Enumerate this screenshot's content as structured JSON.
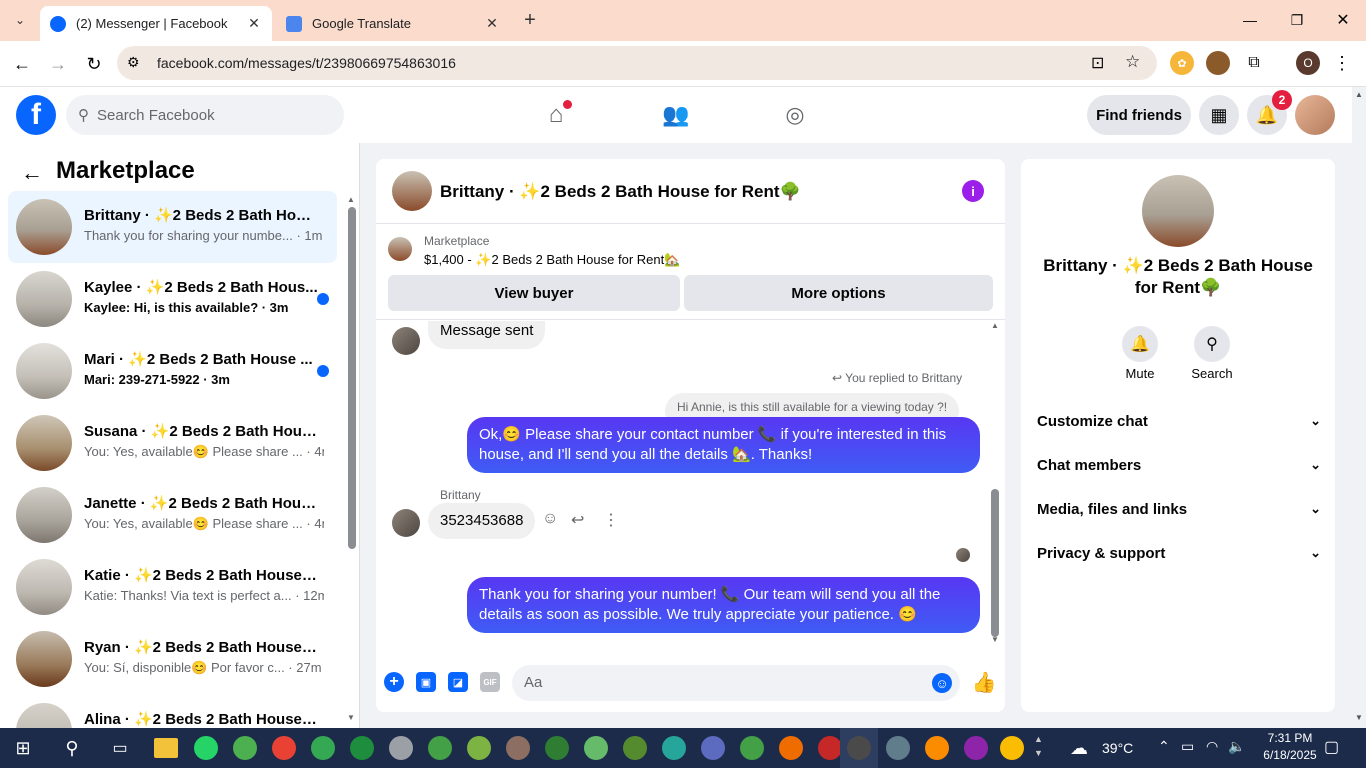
{
  "browser": {
    "tabs": [
      {
        "title": "(2) Messenger | Facebook",
        "icon": "facebook-icon",
        "active": true
      },
      {
        "title": "Google Translate",
        "icon": "translate-icon",
        "active": false
      }
    ],
    "url": "facebook.com/messages/t/23980669754863016"
  },
  "fb_header": {
    "search_placeholder": "Search Facebook",
    "find_friends": "Find friends",
    "notification_count": "2"
  },
  "sidebar": {
    "title": "Marketplace",
    "conversations": [
      {
        "name": "Brittany · ✨2 Beds 2 Bath Hous...",
        "snippet": "Thank you for sharing your numbe... · 1m",
        "unread": false,
        "active": true
      },
      {
        "name": "Kaylee · ✨2 Beds 2 Bath Hous...",
        "snippet": "Kaylee: Hi, is this available? · 3m",
        "unread": true,
        "active": false
      },
      {
        "name": "Mari · ✨2 Beds 2 Bath House ...",
        "snippet": "Mari: 239-271-5922 · 3m",
        "unread": true,
        "active": false
      },
      {
        "name": "Susana · ✨2 Beds 2 Bath House...",
        "snippet": "You: Yes, available😊 Please share ... · 4m",
        "unread": false,
        "active": false
      },
      {
        "name": "Janette · ✨2 Beds 2 Bath House...",
        "snippet": "You: Yes, available😊 Please share ... · 4m",
        "unread": false,
        "active": false
      },
      {
        "name": "Katie · ✨2 Beds 2 Bath House f...",
        "snippet": "Katie: Thanks! Via text is perfect a... · 12m",
        "unread": false,
        "active": false
      },
      {
        "name": "Ryan · ✨2 Beds 2 Bath House f...",
        "snippet": "You: Sí, disponible😊 Por favor c... · 27m",
        "unread": false,
        "active": false
      },
      {
        "name": "Alina · ✨2 Beds 2 Bath House f...",
        "snippet": "",
        "unread": false,
        "active": false
      }
    ]
  },
  "chat": {
    "title": "Brittany · ✨2 Beds 2 Bath House for Rent🌳",
    "listing_label": "Marketplace",
    "listing_detail": "$1,400 - ✨2 Beds 2 Bath House for Rent🏡",
    "view_buyer": "View buyer",
    "more_options": "More options",
    "messages": {
      "message_sent": "Message sent",
      "replied_label": "You replied to Brittany",
      "quoted": "Hi Annie, is this still available for a viewing today ?!",
      "outgoing_1": "Ok,😊 Please share your contact number 📞 if you're interested in this house, and I'll send you all the details 🏡. Thanks!",
      "sender_name": "Brittany",
      "incoming_number": "3523453688",
      "outgoing_2": "Thank you for sharing your number! 📞 Our team will send you all the details as soon as possible. We truly appreciate your patience. 😊"
    },
    "composer_placeholder": "Aa"
  },
  "info_panel": {
    "title": "Brittany · ✨2 Beds 2 Bath House for Rent🌳",
    "mute": "Mute",
    "search": "Search",
    "sections": [
      "Customize chat",
      "Chat members",
      "Media, files and links",
      "Privacy & support"
    ]
  },
  "taskbar": {
    "temperature": "39°C",
    "time": "7:31 PM",
    "date": "6/18/2025"
  },
  "colors": {
    "fb_blue": "#0866ff",
    "bubble_out": "#5b3cf5",
    "notification_red": "#e41e3f"
  }
}
